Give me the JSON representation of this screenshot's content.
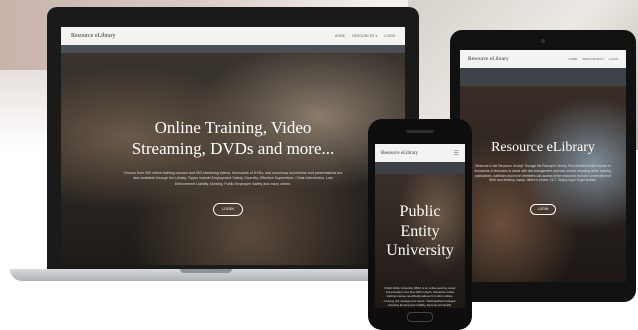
{
  "laptop": {
    "brand": "Resource eLibrary",
    "nav": [
      "HOME",
      "RESOURCES ▾",
      "LOGIN"
    ],
    "hero_title_line1": "Online Training, Video",
    "hero_title_line2": "Streaming, DVDs and more...",
    "hero_text": "Choose from 300 online training courses and 500 streaming videos, thousands of DVDs, and numerous documents and presentations are also available through the Library. Topics include Employment Safety, Diversity, Effective Supervision, Crisis Intervention, Law Enforcement Liability, Nursing, Public Employee Safety and many others.",
    "button": "LOGIN"
  },
  "tablet": {
    "brand": "Resource eLibrary",
    "nav": [
      "HOME",
      "RESOURCES ▾",
      "LOGIN"
    ],
    "hero_title": "Resource eLibrary",
    "hero_text": "Welcome to the Resource Library! Through the Resource Library, Pool Members have access to thousands of resources to assist with risk management and loss control, including online training, publications, webinars and more! Members can access these resources from the convenience of their own desktop, laptop, tablet or phone, 24/7. Simply log in to get started.",
    "button": "LOGIN"
  },
  "phone": {
    "brand": "Resource eLibrary",
    "menu_icon": "☰",
    "hero_line1": "Public",
    "hero_line2": "Entity",
    "hero_line3": "University",
    "hero_text": "Public Entity University (PEU) is an online learning center that provides more than 300 in-depth, interactive online training courses specifically tailored for public entities, covering risk management topics. \"Distinguished Colleges\" including Employment Liability, Security and Health, Effective Supervision and Law Enforcement."
  }
}
